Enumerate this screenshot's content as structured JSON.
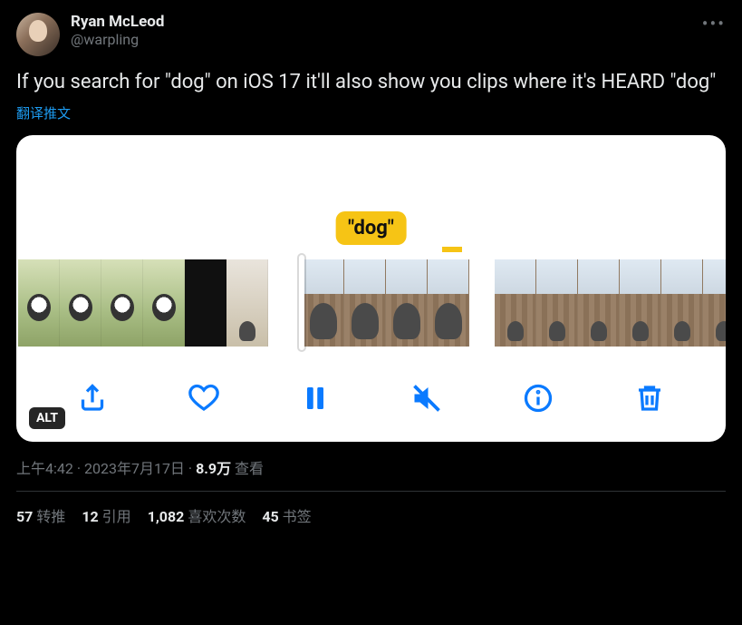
{
  "author": {
    "display_name": "Ryan McLeod",
    "handle": "@warpling"
  },
  "tweet_text": "If you search for \"dog\" on iOS 17 it'll also show you clips where it's HEARD \"dog\"",
  "translate_label": "翻译推文",
  "media": {
    "badge": "\"dog\"",
    "alt_label": "ALT"
  },
  "meta": {
    "time": "上午4:42",
    "date": "2023年7月17日",
    "views_number": "8.9万",
    "views_label": "查看",
    "separator": " · "
  },
  "stats": {
    "retweets_num": "57",
    "retweets_label": "转推",
    "quotes_num": "12",
    "quotes_label": "引用",
    "likes_num": "1,082",
    "likes_label": "喜欢次数",
    "bookmarks_num": "45",
    "bookmarks_label": "书签"
  }
}
